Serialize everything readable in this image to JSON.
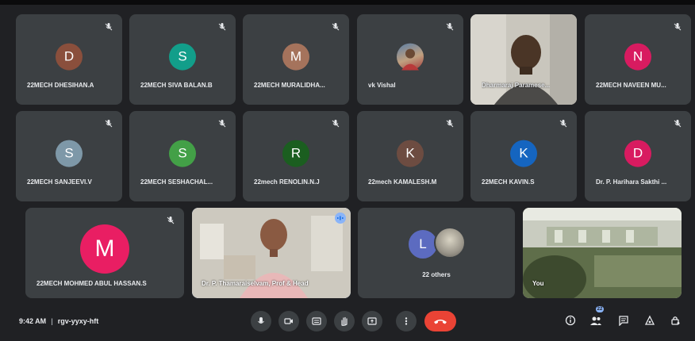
{
  "tiles_row1": [
    {
      "name": "22MECH DHESIHAN.A",
      "initial": "D",
      "color": "#8a4f3c"
    },
    {
      "name": "22MECH SIVA BALAN.B",
      "initial": "S",
      "color": "#129e8a"
    },
    {
      "name": "22MECH MURALIDHA...",
      "initial": "M",
      "color": "#a5735c"
    },
    {
      "name": "vk Vishal",
      "initial": "",
      "color": "#4a6a8a"
    },
    {
      "name": "Dharmaraj Paramese...",
      "initial": "",
      "color": "#6a6a6a"
    },
    {
      "name": "22MECH NAVEEN MU...",
      "initial": "N",
      "color": "#d81b60"
    }
  ],
  "tiles_row2": [
    {
      "name": "22MECH SANJEEVI.V",
      "initial": "S",
      "color": "#7e98a8"
    },
    {
      "name": "22MECH SESHACHAL...",
      "initial": "S",
      "color": "#43a047"
    },
    {
      "name": "22mech RENOLIN.N.J",
      "initial": "R",
      "color": "#1b5e20"
    },
    {
      "name": "22mech KAMALESH.M",
      "initial": "K",
      "color": "#6d4c41"
    },
    {
      "name": "22MECH KAVIN.S",
      "initial": "K",
      "color": "#1565c0"
    },
    {
      "name": "Dr. P. Harihara Sakthi ...",
      "initial": "D",
      "color": "#d81b60"
    }
  ],
  "tile_big": {
    "name": "22MECH MOHMED ABUL HASSAN.S",
    "initial": "M",
    "color": "#e91e63"
  },
  "presenter": {
    "name": "Dr. P. Thamaraiselvam, Prof & Head"
  },
  "others": {
    "label": "22 others",
    "initial": "L",
    "color": "#5c6bc0"
  },
  "self_view": {
    "name": "You"
  },
  "meeting": {
    "time": "9:42 AM",
    "code": "rgv-yyxy-hft"
  },
  "participants_count": "22",
  "controls": [
    "mic-icon",
    "camera-icon",
    "captions-icon",
    "raise-hand-icon",
    "present-icon",
    "more-options-icon"
  ],
  "right_controls": [
    "info-icon",
    "people-icon",
    "chat-icon",
    "activities-icon",
    "host-controls-icon"
  ],
  "colors": {
    "background": "#202124",
    "tile": "#3c4043",
    "end_call": "#ea4335",
    "active_speaker": "#8ab4f8"
  }
}
